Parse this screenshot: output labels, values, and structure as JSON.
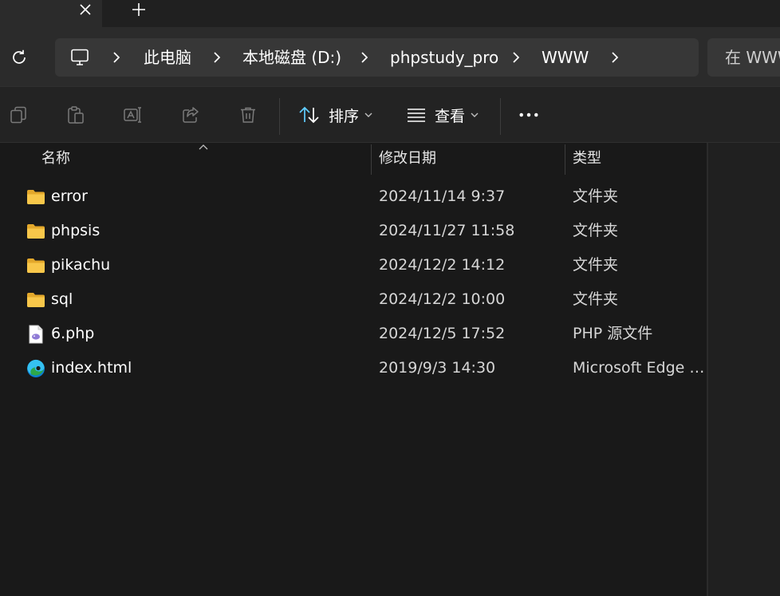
{
  "tabs": {
    "close_icon": "close-icon",
    "new_tab_icon": "plus-icon"
  },
  "address": {
    "refresh_icon": "refresh-icon",
    "pc_icon": "this-pc-icon",
    "separator_icon": "chevron-right-icon",
    "crumbs": [
      "此电脑",
      "本地磁盘 (D:)",
      "phpstudy_pro",
      "WWW"
    ],
    "search_placeholder": "在 WWW 中搜索"
  },
  "toolbar": {
    "copy_icon": "copy-icon",
    "paste_icon": "paste-icon",
    "rename_icon": "rename-icon",
    "share_icon": "share-icon",
    "delete_icon": "trash-icon",
    "sort_label": "排序",
    "sort_icon": "sort-icon",
    "view_label": "查看",
    "view_icon": "view-lines-icon",
    "more_icon": "more-icon"
  },
  "columns": {
    "name": "名称",
    "modified": "修改日期",
    "type": "类型"
  },
  "files": [
    {
      "name": "error",
      "date": "2024/11/14 9:37",
      "type": "文件夹",
      "icon": "folder-icon"
    },
    {
      "name": "phpsis",
      "date": "2024/11/27 11:58",
      "type": "文件夹",
      "icon": "folder-icon"
    },
    {
      "name": "pikachu",
      "date": "2024/12/2 14:12",
      "type": "文件夹",
      "icon": "folder-icon"
    },
    {
      "name": "sql",
      "date": "2024/12/2 10:00",
      "type": "文件夹",
      "icon": "folder-icon"
    },
    {
      "name": "6.php",
      "date": "2024/12/5 17:52",
      "type": "PHP 源文件",
      "icon": "php-file-icon"
    },
    {
      "name": "index.html",
      "date": "2019/9/3 14:30",
      "type": "Microsoft Edge HTML Document",
      "icon": "edge-icon"
    }
  ],
  "colors": {
    "background": "#191919",
    "folder": "#f8c74a",
    "accent": "#60cdff"
  }
}
